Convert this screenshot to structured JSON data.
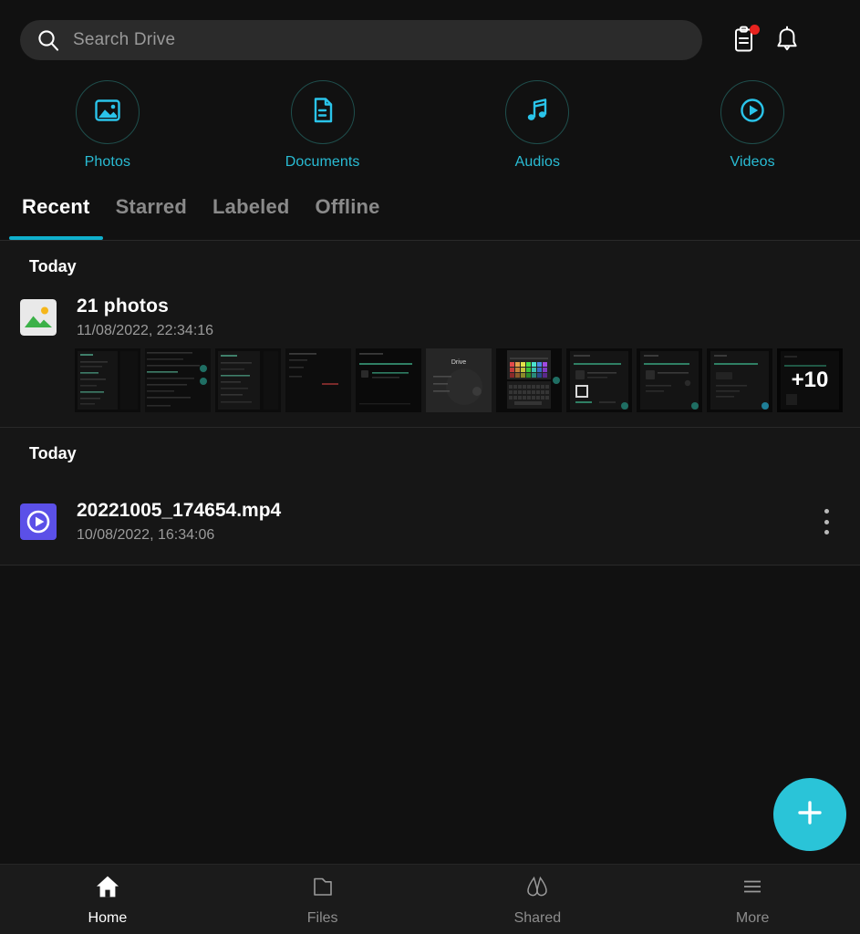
{
  "theme": {
    "background": "#111111",
    "surface": "#161616",
    "accent": "#2ac4d8",
    "accent_tab": "#0fb0cd",
    "quick_label_color": "#29bcd4",
    "badge_color": "#e8231f",
    "muted_text": "#9b9b9b",
    "bottom_nav_bg": "#1b1b1b"
  },
  "search": {
    "placeholder": "Search Drive",
    "icon": "search-icon"
  },
  "topbar_actions": [
    {
      "name": "notes-clipboard-icon",
      "has_badge": true
    },
    {
      "name": "notifications-bell-icon",
      "has_badge": false
    }
  ],
  "quick_access": [
    {
      "label": "Photos",
      "icon": "image-icon"
    },
    {
      "label": "Documents",
      "icon": "document-icon"
    },
    {
      "label": "Audios",
      "icon": "music-note-icon"
    },
    {
      "label": "Videos",
      "icon": "play-circle-icon"
    }
  ],
  "tabs": [
    {
      "label": "Recent",
      "active": true
    },
    {
      "label": "Starred",
      "active": false
    },
    {
      "label": "Labeled",
      "active": false
    },
    {
      "label": "Offline",
      "active": false
    }
  ],
  "groups": [
    {
      "header": "Today",
      "type": "photo_bundle",
      "title": "21 photos",
      "timestamp": "11/08/2022, 22:34:16",
      "icon": "photo-stack-icon",
      "thumbnail_count_visible": 11,
      "more_overlay": "+10"
    },
    {
      "header": "Today",
      "type": "file",
      "title": "20221005_174654.mp4",
      "timestamp": "10/08/2022, 16:34:06",
      "icon": "video-file-icon",
      "menu_icon": "kebab-menu-icon"
    }
  ],
  "fab": {
    "label": "+",
    "icon": "plus-icon"
  },
  "bottom_nav": [
    {
      "label": "Home",
      "icon": "home-icon",
      "active": true
    },
    {
      "label": "Files",
      "icon": "folder-icon",
      "active": false
    },
    {
      "label": "Shared",
      "icon": "shared-icon",
      "active": false
    },
    {
      "label": "More",
      "icon": "menu-icon",
      "active": false
    }
  ]
}
